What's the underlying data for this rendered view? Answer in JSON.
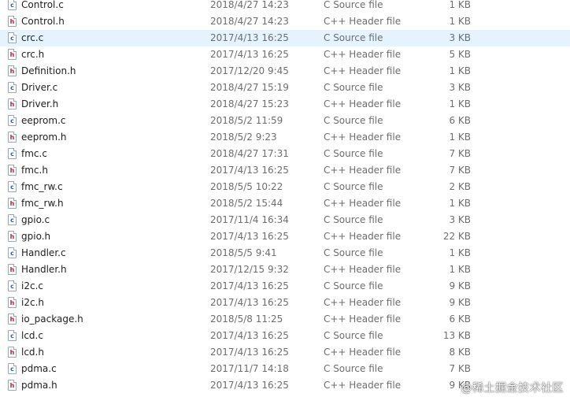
{
  "files": [
    {
      "name": "Control.c",
      "modified": "2018/4/27 14:23",
      "type": "C Source file",
      "size": "1 KB",
      "icon": "c-source-file-icon",
      "selected": false
    },
    {
      "name": "Control.h",
      "modified": "2018/4/27 14:23",
      "type": "C++ Header file",
      "size": "1 KB",
      "icon": "header-file-icon",
      "selected": false
    },
    {
      "name": "crc.c",
      "modified": "2017/4/13 16:25",
      "type": "C Source file",
      "size": "3 KB",
      "icon": "c-source-file-icon",
      "selected": true
    },
    {
      "name": "crc.h",
      "modified": "2017/4/13 16:25",
      "type": "C++ Header file",
      "size": "5 KB",
      "icon": "header-file-icon",
      "selected": false
    },
    {
      "name": "Definition.h",
      "modified": "2017/12/20 9:45",
      "type": "C++ Header file",
      "size": "1 KB",
      "icon": "header-file-icon",
      "selected": false
    },
    {
      "name": "Driver.c",
      "modified": "2018/4/27 15:19",
      "type": "C Source file",
      "size": "3 KB",
      "icon": "c-source-file-icon",
      "selected": false
    },
    {
      "name": "Driver.h",
      "modified": "2018/4/27 15:23",
      "type": "C++ Header file",
      "size": "1 KB",
      "icon": "header-file-icon",
      "selected": false
    },
    {
      "name": "eeprom.c",
      "modified": "2018/5/2 11:59",
      "type": "C Source file",
      "size": "6 KB",
      "icon": "c-source-file-icon",
      "selected": false
    },
    {
      "name": "eeprom.h",
      "modified": "2018/5/2 9:23",
      "type": "C++ Header file",
      "size": "1 KB",
      "icon": "header-file-icon",
      "selected": false
    },
    {
      "name": "fmc.c",
      "modified": "2018/4/27 17:31",
      "type": "C Source file",
      "size": "7 KB",
      "icon": "c-source-file-icon",
      "selected": false
    },
    {
      "name": "fmc.h",
      "modified": "2017/4/13 16:25",
      "type": "C++ Header file",
      "size": "7 KB",
      "icon": "header-file-icon",
      "selected": false
    },
    {
      "name": "fmc_rw.c",
      "modified": "2018/5/5 10:22",
      "type": "C Source file",
      "size": "2 KB",
      "icon": "c-source-file-icon",
      "selected": false
    },
    {
      "name": "fmc_rw.h",
      "modified": "2018/5/2 15:44",
      "type": "C++ Header file",
      "size": "1 KB",
      "icon": "header-file-icon",
      "selected": false
    },
    {
      "name": "gpio.c",
      "modified": "2017/11/4 16:34",
      "type": "C Source file",
      "size": "3 KB",
      "icon": "c-source-file-icon",
      "selected": false
    },
    {
      "name": "gpio.h",
      "modified": "2017/4/13 16:25",
      "type": "C++ Header file",
      "size": "22 KB",
      "icon": "header-file-icon",
      "selected": false
    },
    {
      "name": "Handler.c",
      "modified": "2018/5/5 9:41",
      "type": "C Source file",
      "size": "1 KB",
      "icon": "c-source-file-icon",
      "selected": false
    },
    {
      "name": "Handler.h",
      "modified": "2017/12/15 9:32",
      "type": "C++ Header file",
      "size": "1 KB",
      "icon": "header-file-icon",
      "selected": false
    },
    {
      "name": "i2c.c",
      "modified": "2017/4/13 16:25",
      "type": "C Source file",
      "size": "9 KB",
      "icon": "c-source-file-icon",
      "selected": false
    },
    {
      "name": "i2c.h",
      "modified": "2017/4/13 16:25",
      "type": "C++ Header file",
      "size": "9 KB",
      "icon": "header-file-icon",
      "selected": false
    },
    {
      "name": "io_package.h",
      "modified": "2018/5/8 11:25",
      "type": "C++ Header file",
      "size": "6 KB",
      "icon": "header-file-icon",
      "selected": false
    },
    {
      "name": "lcd.c",
      "modified": "2017/4/13 16:25",
      "type": "C Source file",
      "size": "13 KB",
      "icon": "c-source-file-icon",
      "selected": false
    },
    {
      "name": "lcd.h",
      "modified": "2017/4/13 16:25",
      "type": "C++ Header file",
      "size": "8 KB",
      "icon": "header-file-icon",
      "selected": false
    },
    {
      "name": "pdma.c",
      "modified": "2017/11/7 14:18",
      "type": "C Source file",
      "size": "7 KB",
      "icon": "c-source-file-icon",
      "selected": false
    },
    {
      "name": "pdma.h",
      "modified": "2017/4/13 16:25",
      "type": "C++ Header file",
      "size": "9 KB",
      "icon": "header-file-icon",
      "selected": false
    }
  ],
  "watermark": "@稀土掘金技术社区",
  "colors": {
    "selected_row": "#e5f3ff",
    "secondary_text": "#6d6d6d",
    "c_icon_letter": "#2b5fb3",
    "h_icon_letter": "#b8232b"
  }
}
